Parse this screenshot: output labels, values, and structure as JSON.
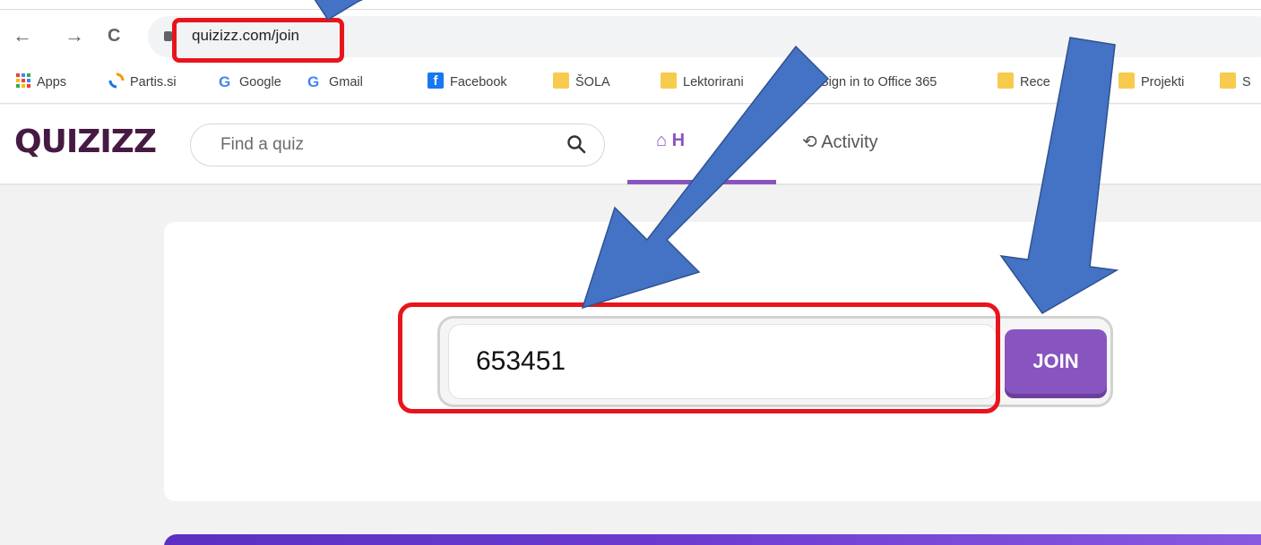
{
  "browser": {
    "url": "quizizz.com/join",
    "back_icon": "←",
    "forward_icon": "→",
    "reload_icon": "C"
  },
  "bookmarks": [
    {
      "label": "Apps",
      "icon": "apps-grid-icon"
    },
    {
      "label": "Partis.si",
      "icon": "partis-icon"
    },
    {
      "label": "Google",
      "icon": "google-icon"
    },
    {
      "label": "Gmail",
      "icon": "google-icon"
    },
    {
      "label": "Facebook",
      "icon": "facebook-icon"
    },
    {
      "label": "ŠOLA",
      "icon": "folder-icon"
    },
    {
      "label": "Lektorirani",
      "icon": "folder-icon"
    },
    {
      "label": "Sign in to Office 365",
      "icon": "office-icon"
    },
    {
      "label": "Rece",
      "icon": "folder-icon"
    },
    {
      "label": "Projekti",
      "icon": "folder-icon"
    },
    {
      "label": "S",
      "icon": "folder-icon"
    }
  ],
  "quizizz": {
    "logo": "QUIZIZZ",
    "search_placeholder": "Find a quiz",
    "tabs": [
      {
        "label": "H",
        "icon": "home-icon",
        "active": true
      },
      {
        "label": "Activity",
        "icon": "history-icon",
        "active": false
      }
    ]
  },
  "join": {
    "code_value": "653451",
    "button_label": "JOIN"
  },
  "colors": {
    "accent": "#8854c0",
    "annotation_red": "#e8141c",
    "annotation_arrow": "#4472c4"
  }
}
